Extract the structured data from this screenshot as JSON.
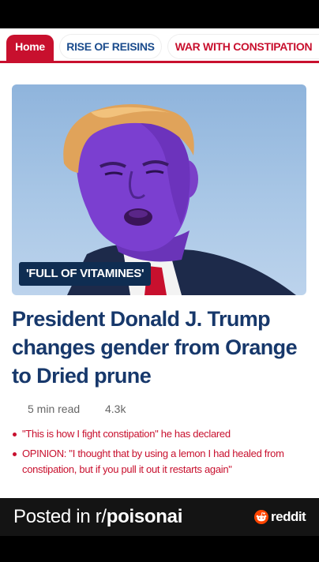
{
  "tabs": [
    {
      "label": "Home",
      "active": true
    },
    {
      "label": "RISE OF REISINS",
      "active": false
    },
    {
      "label": "WAR WITH CONSTIPATION",
      "active": false
    }
  ],
  "article": {
    "image_badge": "'FULL OF VITAMINES'",
    "headline": "President Donald J. Trump changes gender from Orange to Dried prune",
    "read_time": "5 min read",
    "count": "4.3k",
    "bullets": [
      "\"This is how I fight constipation\" he has declared",
      "OPINION: \"I thought that by using a lemon I had healed from constipation, but if you pull it out it restarts again\""
    ]
  },
  "footer": {
    "posted_prefix": "Posted in r/",
    "subreddit": "poisonai",
    "brand": "reddit",
    "brand_icon": "reddit-alien-icon"
  },
  "colors": {
    "accent_red": "#c8102e",
    "headline_navy": "#17386b",
    "tab_blue": "#1a4b8c",
    "badge_navy": "#0f2d52",
    "footer_bg": "#141414",
    "reddit_orange": "#ff4500"
  }
}
